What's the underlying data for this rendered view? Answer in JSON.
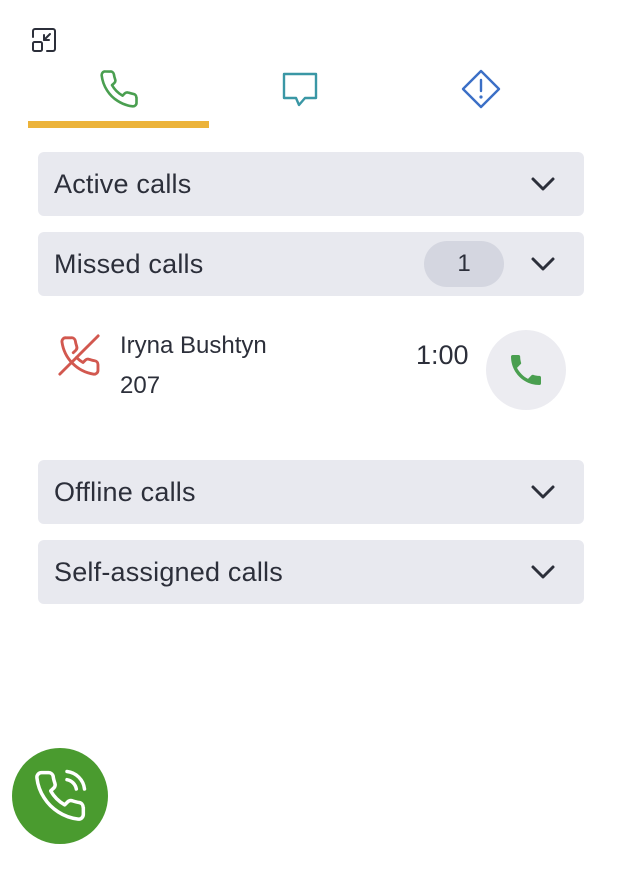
{
  "toolbar": {
    "minimize_icon": "minimize-icon"
  },
  "tabs": [
    {
      "id": "calls",
      "icon": "phone-icon",
      "active": true,
      "color": "#4a9f50"
    },
    {
      "id": "chat",
      "icon": "chat-bubble-icon",
      "active": false,
      "color": "#3a97a5"
    },
    {
      "id": "alerts",
      "icon": "alert-diamond-icon",
      "active": false,
      "color": "#3b6fc6"
    }
  ],
  "sections": {
    "active": {
      "label": "Active calls"
    },
    "missed": {
      "label": "Missed calls",
      "count": "1"
    },
    "offline": {
      "label": "Offline calls"
    },
    "self_assigned": {
      "label": "Self-assigned calls"
    }
  },
  "missed_calls": [
    {
      "name": "Iryna Bushtyn",
      "extension": "207",
      "time": "1:00"
    }
  ],
  "colors": {
    "accent_tab": "#ecb33a",
    "missed_red": "#d2584f",
    "call_green": "#4a9f50",
    "fab_green": "#4a9b2f",
    "section_bg": "#e8e9ef"
  }
}
